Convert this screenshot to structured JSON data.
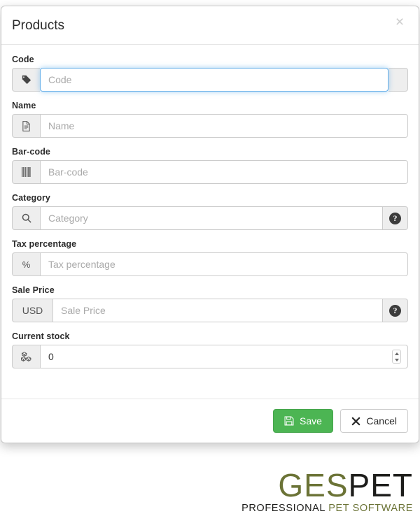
{
  "modal": {
    "title": "Products",
    "close_icon": "close-icon",
    "close_label": "×"
  },
  "form": {
    "fields": [
      {
        "key": "code",
        "label": "Code",
        "placeholder": "Code",
        "value": "",
        "icon": "tag-icon",
        "focused": true,
        "right_addon": "blank"
      },
      {
        "key": "name",
        "label": "Name",
        "placeholder": "Name",
        "value": "",
        "icon": "file-text-icon",
        "focused": false,
        "right_addon": "none"
      },
      {
        "key": "barcode",
        "label": "Bar-code",
        "placeholder": "Bar-code",
        "value": "",
        "icon": "barcode-icon",
        "focused": false,
        "right_addon": "none"
      },
      {
        "key": "category",
        "label": "Category",
        "placeholder": "Category",
        "value": "",
        "icon": "search-icon",
        "focused": false,
        "right_addon": "help"
      },
      {
        "key": "tax_percentage",
        "label": "Tax percentage",
        "placeholder": "Tax percentage",
        "value": "",
        "icon": "percent-icon",
        "focused": false,
        "right_addon": "none"
      },
      {
        "key": "sale_price",
        "label": "Sale Price",
        "placeholder": "Sale Price",
        "value": "",
        "icon": "currency-text",
        "icon_text": "USD",
        "focused": false,
        "right_addon": "help"
      },
      {
        "key": "current_stock",
        "label": "Current stock",
        "placeholder": "",
        "value": "0",
        "icon": "cubes-icon",
        "focused": false,
        "right_addon": "spinner"
      }
    ],
    "help_glyph": "?"
  },
  "footer": {
    "save_label": "Save",
    "save_icon": "floppy-save-icon",
    "save_color": "#4cb553",
    "cancel_label": "Cancel",
    "cancel_icon": "times-icon"
  },
  "logo": {
    "part1": "GES",
    "part2": "PET",
    "tagline1": "PROFESSIONAL",
    "tagline2": "PET SOFTWARE",
    "color1": "#6b7336",
    "color2": "#1d1d1b"
  }
}
